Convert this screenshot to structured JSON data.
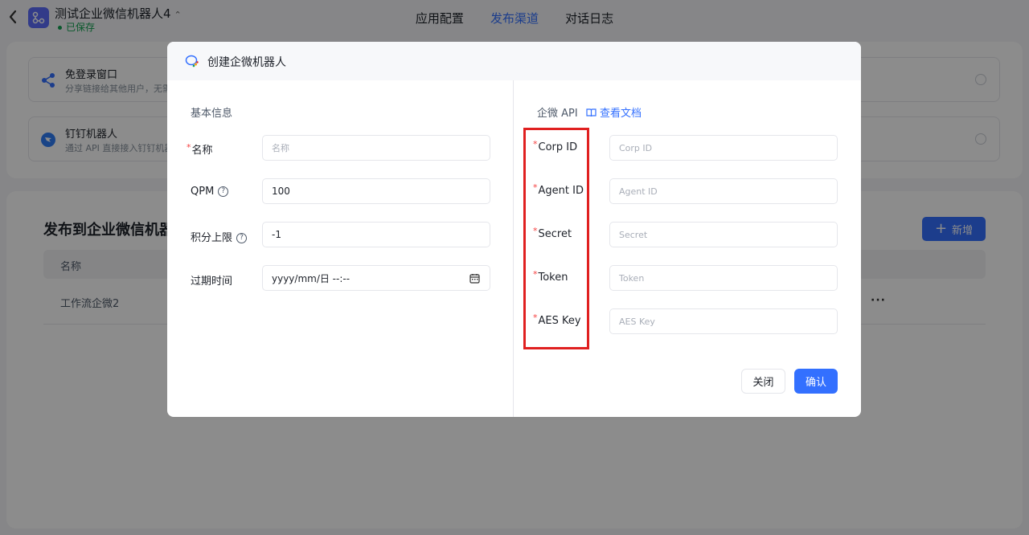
{
  "app": {
    "title": "测试企业微信机器人4",
    "caret": "⌃",
    "saved_status": "已保存"
  },
  "top_tabs": [
    {
      "label": "应用配置",
      "active": false
    },
    {
      "label": "发布渠道",
      "active": true
    },
    {
      "label": "对话日志",
      "active": false
    }
  ],
  "channels": [
    {
      "title": "免登录窗口",
      "desc": "分享链接给其他用户，无需"
    },
    {
      "title": "钉钉机器人",
      "desc": "通过 API 直接接入钉钉机器"
    }
  ],
  "section": {
    "title": "发布到企业微信机器",
    "add_label": "新增",
    "table_header": "名称",
    "rows": [
      {
        "name": "工作流企微2",
        "more": "···"
      }
    ]
  },
  "modal": {
    "title": "创建企微机器人",
    "left": {
      "section_title": "基本信息",
      "name": {
        "label": "名称",
        "placeholder": "名称"
      },
      "qpm": {
        "label": "QPM",
        "value": "100"
      },
      "points": {
        "label": "积分上限",
        "value": "-1"
      },
      "expire": {
        "label": "过期时间",
        "value": "yyyy/mm/日 --:--"
      }
    },
    "right": {
      "section_title": "企微 API",
      "doc_link": "查看文档",
      "fields": [
        {
          "label": "Corp ID",
          "placeholder": "Corp ID"
        },
        {
          "label": "Agent ID",
          "placeholder": "Agent ID"
        },
        {
          "label": "Secret",
          "placeholder": "Secret"
        },
        {
          "label": "Token",
          "placeholder": "Token"
        },
        {
          "label": "AES Key",
          "placeholder": "AES Key"
        }
      ]
    },
    "close_label": "关闭",
    "confirm_label": "确认",
    "required_mark": "*",
    "help_mark": "?"
  },
  "colors": {
    "accent": "#3370ff",
    "saved": "#12a150",
    "required": "#f53f3f",
    "highlight_box": "#e02020"
  }
}
